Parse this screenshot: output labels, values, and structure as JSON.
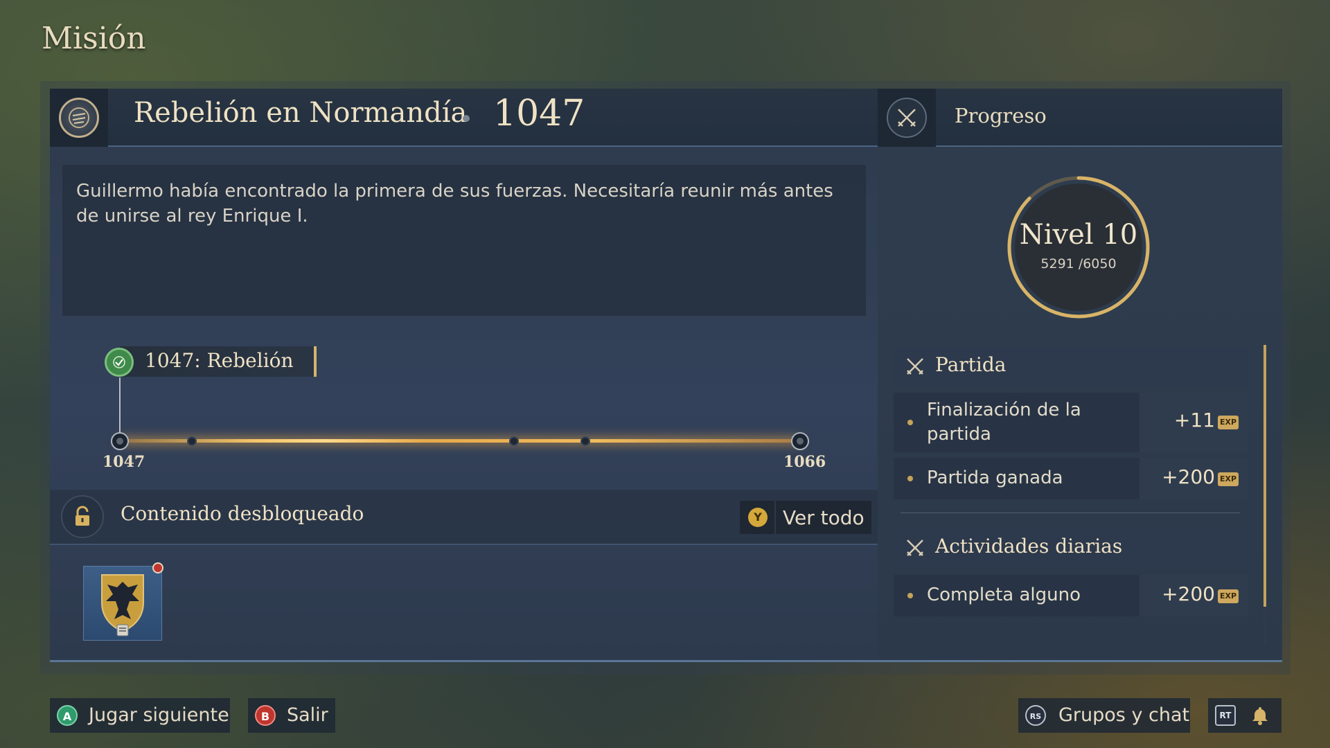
{
  "page": {
    "title": "Misión"
  },
  "mission": {
    "name": "Rebelión en Normandía",
    "year": "1047",
    "description": "Guillermo había encontrado la primera de sus fuerzas. Necesitaría reunir más antes de unirse al rey Enrique I."
  },
  "timeline": {
    "current_label": "1047: Rebelión",
    "start_year": "1047",
    "end_year": "1066",
    "completed": true
  },
  "unlocked": {
    "title": "Contenido desbloqueado",
    "view_all_button": "Y",
    "view_all_label": "Ver todo"
  },
  "progress": {
    "header": "Progreso",
    "level_label": "Nivel 10",
    "exp_current": "5291",
    "exp_separator": "/",
    "exp_max": "6050",
    "exp_fraction": 0.8745
  },
  "sections": [
    {
      "title": "Partida",
      "rows": [
        {
          "label": "Finalización de la partida",
          "value": "+11",
          "unit": "EXP"
        },
        {
          "label": "Partida ganada",
          "value": "+200",
          "unit": "EXP"
        }
      ]
    },
    {
      "title": "Actividades diarias",
      "rows": [
        {
          "label": "Completa alguno",
          "value": "+200",
          "unit": "EXP"
        }
      ]
    }
  ],
  "footer": {
    "play_next": {
      "button": "A",
      "label": "Jugar siguiente",
      "color": "#2f9b6c"
    },
    "exit": {
      "button": "B",
      "label": "Salir",
      "color": "#c0352d"
    },
    "groups": {
      "button": "RS",
      "label": "Grupos y chat"
    },
    "notifications": {
      "button": "RT"
    }
  },
  "colors": {
    "accent_gold": "#d6b46a",
    "panel": "#2e3b4d",
    "check_green": "#3f8a4a"
  }
}
